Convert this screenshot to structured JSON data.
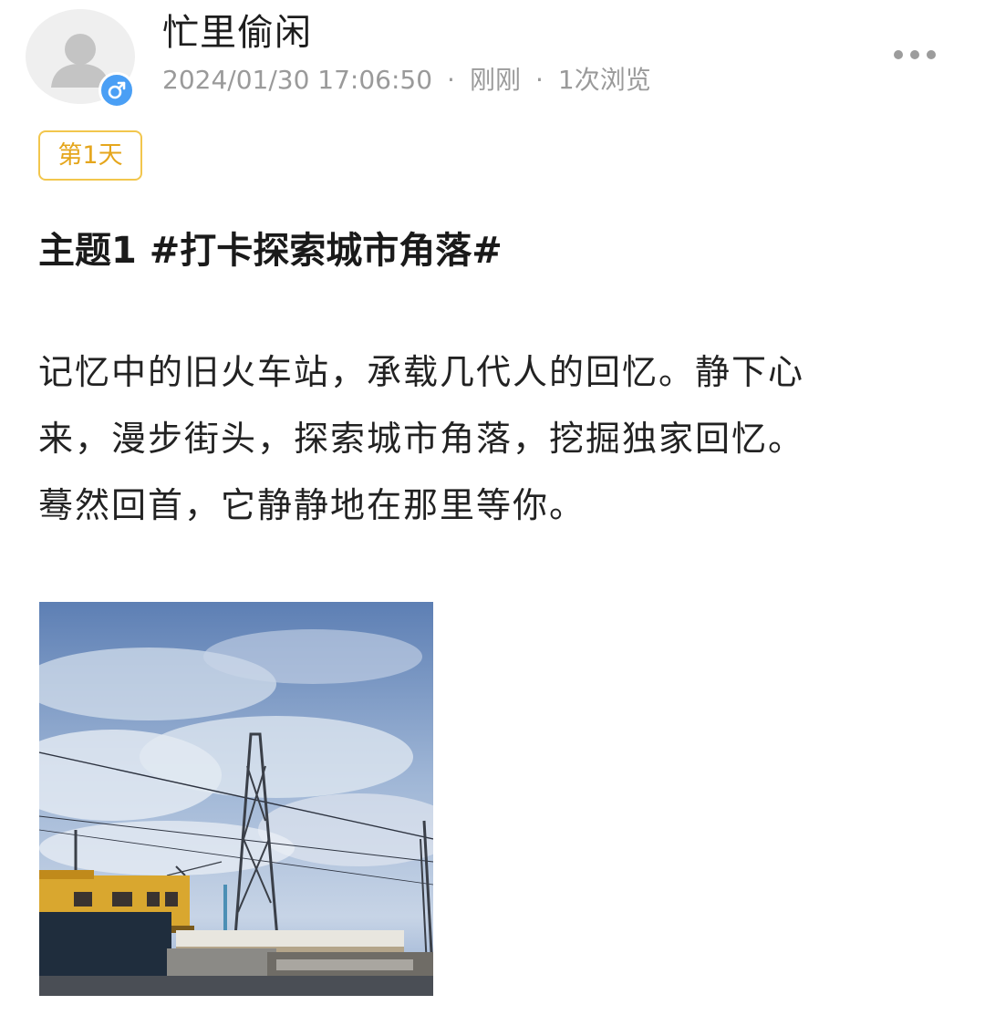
{
  "post": {
    "author": {
      "name": "忙里偷闲",
      "avatar_icon": "default-user-avatar-icon",
      "gender_icon": "male-symbol-icon",
      "gender_badge_color": "#4a9ff5"
    },
    "meta": {
      "datetime": "2024/01/30 17:06:50",
      "separator": "·",
      "relative_time": "刚刚",
      "views": "1次浏览"
    },
    "more_icon": "more-dots-icon",
    "day_tag": {
      "label": "第1天",
      "color": "#e5a61c",
      "border_color": "#f2c64d"
    },
    "topic_title": "主题1 #打卡探索城市角落#",
    "body_lines": [
      "记忆中的旧火车站，承载几代人的回忆。静下心",
      "来，漫步街头，探索城市角落，挖掘独家回忆。",
      "蓦然回首，它静静地在那里等你。"
    ],
    "photo": {
      "icon": "railway-station-photo"
    }
  }
}
